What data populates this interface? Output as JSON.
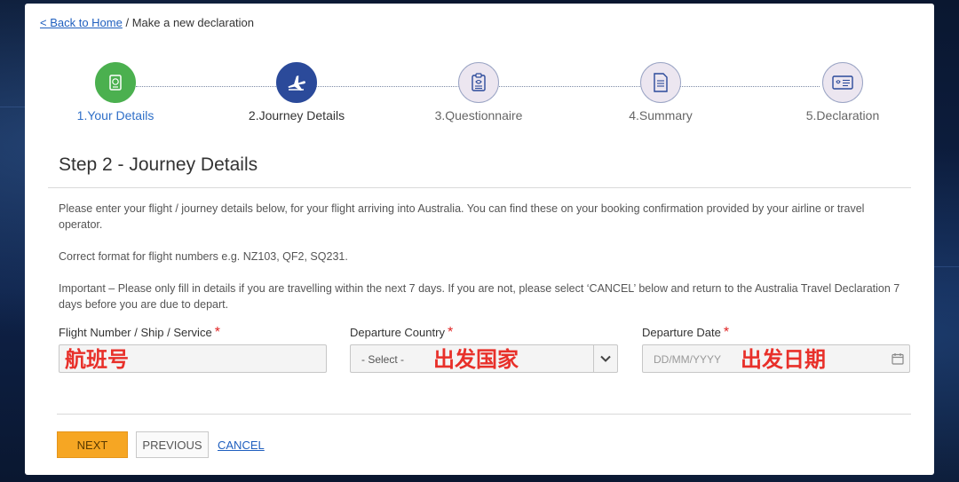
{
  "breadcrumb": {
    "home_link": "< Back to Home",
    "separator": " / ",
    "current": "Make a new declaration"
  },
  "stepper": {
    "steps": [
      {
        "label": "1.Your Details",
        "state": "done",
        "icon": "passport-icon"
      },
      {
        "label": "2.Journey Details",
        "state": "active",
        "icon": "plane-icon"
      },
      {
        "label": "3.Questionnaire",
        "state": "todo",
        "icon": "clipboard-icon"
      },
      {
        "label": "4.Summary",
        "state": "todo",
        "icon": "document-icon"
      },
      {
        "label": "5.Declaration",
        "state": "todo",
        "icon": "id-card-icon"
      }
    ]
  },
  "page": {
    "title": "Step 2 - Journey Details",
    "intro": "Please enter your flight / journey details below, for your flight arriving into Australia. You can find these on your booking confirmation provided by your airline or travel operator.",
    "format_note": "Correct format for flight numbers e.g. NZ103, QF2, SQ231.",
    "important_note": "Important – Please only fill in details if you are travelling within the next 7 days.  If you are not, please select ‘CANCEL’ below and return to the Australia Travel Declaration 7 days before you are due to depart."
  },
  "form": {
    "flight_label": "Flight Number / Ship / Service",
    "flight_value": "",
    "country_label": "Departure Country",
    "country_selected": "- Select -",
    "date_label": "Departure Date",
    "date_placeholder": "DD/MM/YYYY",
    "required_mark": "*"
  },
  "annotations": {
    "flight_cn": "航班号",
    "country_cn": "出发国家",
    "date_cn": "出发日期"
  },
  "buttons": {
    "next": "NEXT",
    "previous": "PREVIOUS",
    "cancel": "CANCEL"
  },
  "colors": {
    "accent_blue": "#2b4a9a",
    "done_green": "#4bb04f",
    "next_orange": "#f6a623",
    "required_red": "#e02424",
    "annotation_red": "#e8302a"
  }
}
